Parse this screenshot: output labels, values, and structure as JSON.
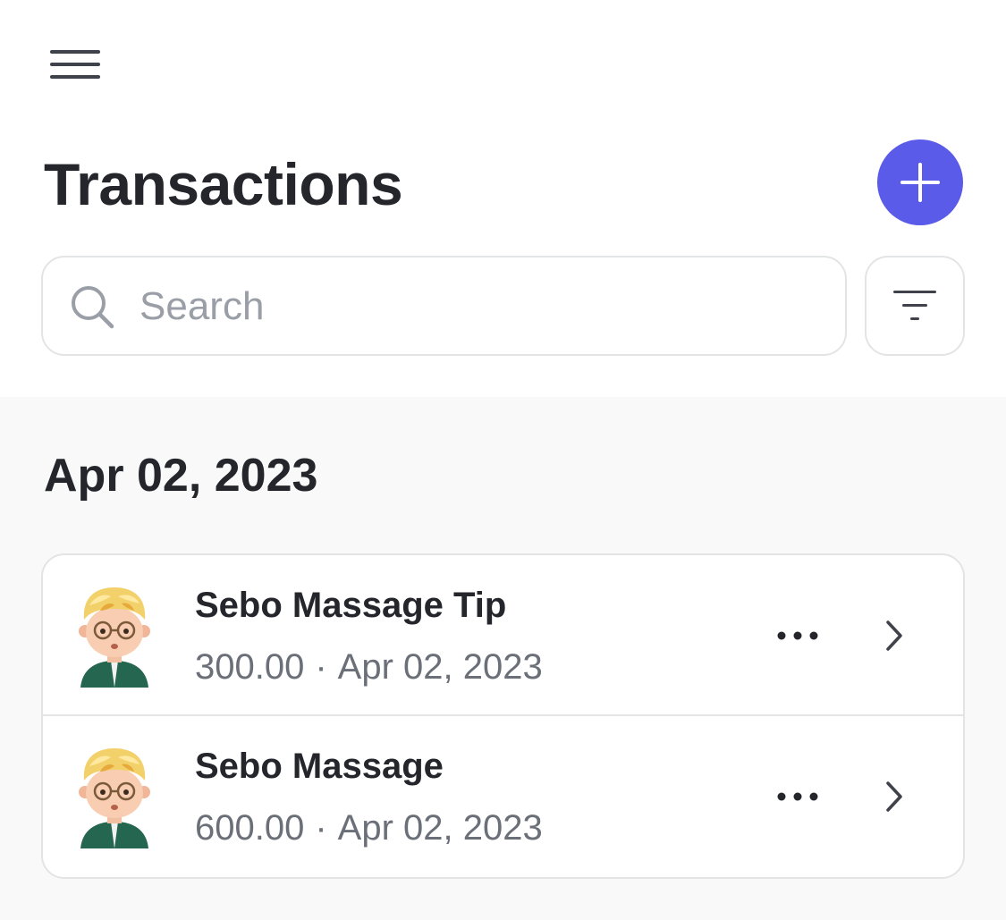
{
  "header": {
    "menu_icon": "hamburger-menu-icon",
    "title": "Transactions",
    "add_icon": "plus-icon",
    "accent_color": "#5a5be8"
  },
  "search": {
    "placeholder": "Search",
    "value": "",
    "icon": "search-icon",
    "filter_icon": "filter-icon"
  },
  "sections": [
    {
      "date": "Apr 02, 2023",
      "items": [
        {
          "title": "Sebo Massage Tip",
          "amount": "300.00",
          "separator": "·",
          "date": "Apr 02, 2023",
          "avatar_icon": "memoji-avatar-icon",
          "more_icon": "more-horizontal-icon",
          "chevron_icon": "chevron-right-icon"
        },
        {
          "title": "Sebo Massage",
          "amount": "600.00",
          "separator": "·",
          "date": "Apr 02, 2023",
          "avatar_icon": "memoji-avatar-icon",
          "more_icon": "more-horizontal-icon",
          "chevron_icon": "chevron-right-icon"
        }
      ]
    }
  ]
}
